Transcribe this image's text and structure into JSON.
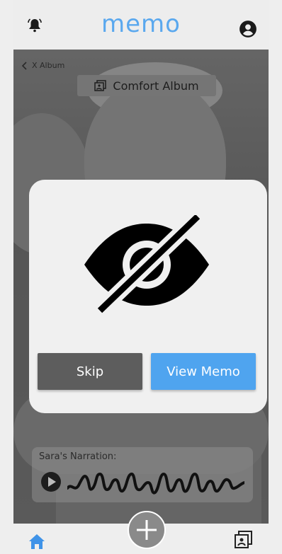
{
  "header": {
    "logo": "memo",
    "icons": {
      "left": "bell-icon",
      "right": "user-account-icon"
    }
  },
  "album": {
    "back_label": "X Album",
    "chip_label": "Comfort Album",
    "chip_icon": "photo-album-icon"
  },
  "modal": {
    "icon": "eye-slash-icon",
    "skip_label": "Skip",
    "view_label": "View Memo"
  },
  "narration": {
    "label": "Sara's Narration:",
    "play_icon": "play-icon",
    "wave_icon": "waveform-icon"
  },
  "footer": {
    "home_icon": "home-icon",
    "add_icon": "plus-icon",
    "albums_icon": "albums-icon"
  },
  "colors": {
    "accent": "#4fa4ef",
    "logo": "#5aa8ee",
    "skip": "#5d5d5d",
    "modal_bg": "#f0f0f0"
  }
}
